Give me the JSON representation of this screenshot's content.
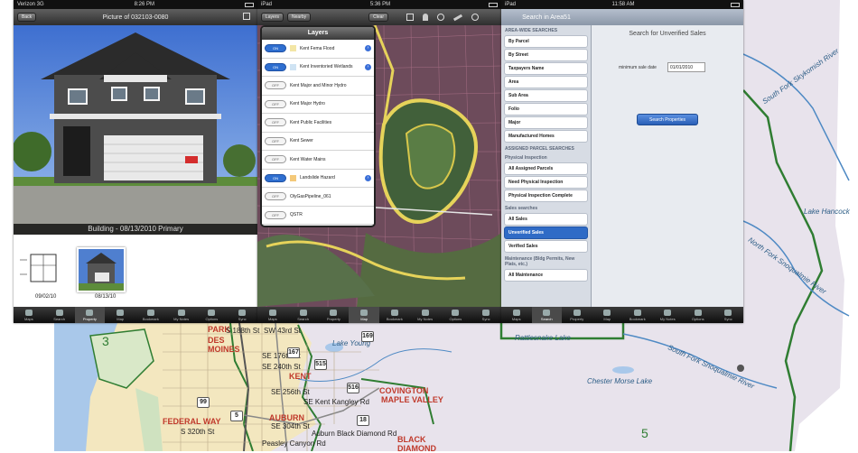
{
  "colors": {
    "map_land": "#e8e3ec",
    "urban": "#f3e7bf",
    "water": "#a9c8ea",
    "boundary": "#2f7d32",
    "ios_blue": "#2f6bc6"
  },
  "property_screen": {
    "status_left": "Verizon 3G",
    "status_center": "8:26 PM",
    "back_label": "Back",
    "title": "Picture of 032103-0080",
    "caption": "Building  -  08/13/2010  Primary",
    "thumbnails": [
      {
        "label": "09/02/10"
      },
      {
        "label": "08/13/10"
      }
    ],
    "tabs": [
      "Maps",
      "Search",
      "Property",
      "Map",
      "Bookmark",
      "My Notes",
      "Options",
      "Sync"
    ],
    "active_tab_index": 2
  },
  "layers_screen": {
    "status_left": "iPad",
    "status_center": "5:36 PM",
    "nav_buttons": [
      "Layers",
      "Nearby",
      "Clear"
    ],
    "popup_title": "Layers",
    "layers": [
      {
        "name": "Kent Fema Flood",
        "state": "ON",
        "swatch": "#f3e6a6",
        "info": true
      },
      {
        "name": "Kent Inventoried Wetlands",
        "state": "ON",
        "swatch": "#cfe3f3",
        "info": true
      },
      {
        "name": "Kent Major and Minor Hydro",
        "state": "OFF",
        "swatch": "",
        "info": false
      },
      {
        "name": "Kent Major Hydro",
        "state": "OFF",
        "swatch": "",
        "info": false
      },
      {
        "name": "Kent Public Facilities",
        "state": "OFF",
        "swatch": "",
        "info": false
      },
      {
        "name": "Kent Sewer",
        "state": "OFF",
        "swatch": "",
        "info": false
      },
      {
        "name": "Kent Water Mains",
        "state": "OFF",
        "swatch": "",
        "info": false
      },
      {
        "name": "Landslide Hazard",
        "state": "ON",
        "swatch": "#f4c97a",
        "info": true
      },
      {
        "name": "OlyGasPipeline_061",
        "state": "OFF",
        "swatch": "",
        "info": false
      },
      {
        "name": "QSTR",
        "state": "OFF",
        "swatch": "",
        "info": false
      }
    ],
    "tabs": [
      "Maps",
      "Search",
      "Property",
      "Map",
      "Bookmark",
      "My Notes",
      "Options",
      "Sync"
    ],
    "active_tab_index": 3
  },
  "search_screen": {
    "status_left": "iPad",
    "status_center": "11:58 AM",
    "title": "Search in Area51",
    "sections": [
      {
        "head": "AREA-WIDE SEARCHES",
        "items": [
          "By Parcel",
          "By Street",
          "Taxpayers Name",
          "Area",
          "Sub Area",
          "Folio",
          "Major",
          "Manufactured Homes"
        ]
      },
      {
        "head": "ASSIGNED PARCEL SEARCHES",
        "items": []
      },
      {
        "head": "Physical Inspection",
        "items": [
          "All Assigned Parcels",
          "Need Physical Inspection",
          "Physical Inspection Complete"
        ]
      },
      {
        "head": "Sales searches",
        "items": [
          "All Sales",
          "Unverified Sales",
          "Verified Sales"
        ]
      },
      {
        "head": "Maintenance (Bldg Permits, New Plats, etc.)",
        "items": [
          "All Maintenance"
        ]
      }
    ],
    "selected_item": "Unverified Sales",
    "heading": "Search for Unverified Sales",
    "date_label": "minimum sale date",
    "date_value": "01/01/2010",
    "search_button": "Search Properties",
    "tabs": [
      "Maps",
      "Search",
      "Property",
      "Map",
      "Bookmark",
      "My Notes",
      "Options",
      "Sync"
    ],
    "active_tab_index": 1
  },
  "map": {
    "districts": [
      "3",
      "5"
    ],
    "cities": [
      "PARK",
      "DES MOINES",
      "KENT",
      "COVINGTON",
      "MAPLE VALLEY",
      "FEDERAL WAY",
      "AUBURN",
      "BLACK DIAMOND"
    ],
    "roads": [
      "S 188th St",
      "SW 43rd St",
      "SE 240th St",
      "SE 256th St",
      "SE Kent Kangley Rd",
      "SE 304th St",
      "S 320th St",
      "Peasley Canyon Rd",
      "Auburn Black Diamond Rd",
      "SE 176th St"
    ],
    "water": [
      "Lake Young",
      "South Fork Skykomish River",
      "North Fork Snoqualmie River",
      "South Fork Snoqualmie River",
      "Chester Morse Lake",
      "Rattlesnake Lake",
      "Lake Hancock"
    ],
    "highways": [
      "167",
      "169",
      "18",
      "515",
      "5",
      "516",
      "99"
    ]
  }
}
